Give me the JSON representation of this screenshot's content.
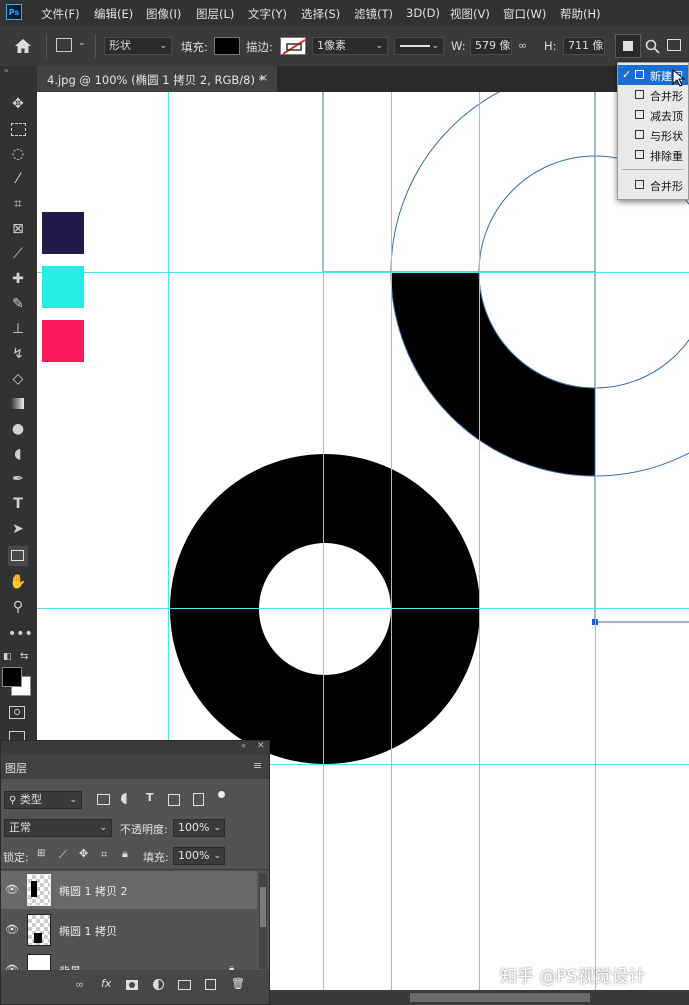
{
  "app": {
    "logo": "Ps"
  },
  "menu": [
    "文件(F)",
    "编辑(E)",
    "图像(I)",
    "图层(L)",
    "文字(Y)",
    "选择(S)",
    "滤镜(T)",
    "3D(D)",
    "视图(V)",
    "窗口(W)",
    "帮助(H)"
  ],
  "options": {
    "mode": "形状",
    "fill_label": "填充:",
    "stroke_label": "描边:",
    "stroke_width": "1像素",
    "w_label": "W:",
    "w_value": "579 像!",
    "h_label": "H:",
    "h_value": "711 像!"
  },
  "document": {
    "tab_label": "4.jpg @ 100% (椭圆 1 拷贝 2, RGB/8) *",
    "close": "×"
  },
  "swatches": [
    "#23194a",
    "#26ebe6",
    "#fa1a5a"
  ],
  "path_ops_menu": [
    {
      "label": "新建图",
      "selected": true,
      "check": "✓"
    },
    {
      "label": "合并形"
    },
    {
      "label": "减去顶"
    },
    {
      "label": "与形状"
    },
    {
      "label": "排除重"
    },
    {
      "label": "合并形"
    }
  ],
  "layers_panel": {
    "title": "图层",
    "filter": "类型",
    "blend_mode": "正常",
    "opacity_label": "不透明度:",
    "opacity": "100%",
    "lock_label": "锁定:",
    "fill_label": "填充:",
    "fill": "100%",
    "layers": [
      {
        "name": "椭圆 1 拷贝 2",
        "selected": true
      },
      {
        "name": "椭圆 1 拷贝",
        "selected": false
      },
      {
        "name": "背景",
        "selected": false
      }
    ]
  },
  "watermark": "知乎 @PS视觉设计",
  "colors": {
    "guide": "#4de3f0",
    "path": "#3a6ea5",
    "selection": "#0a64c8"
  }
}
